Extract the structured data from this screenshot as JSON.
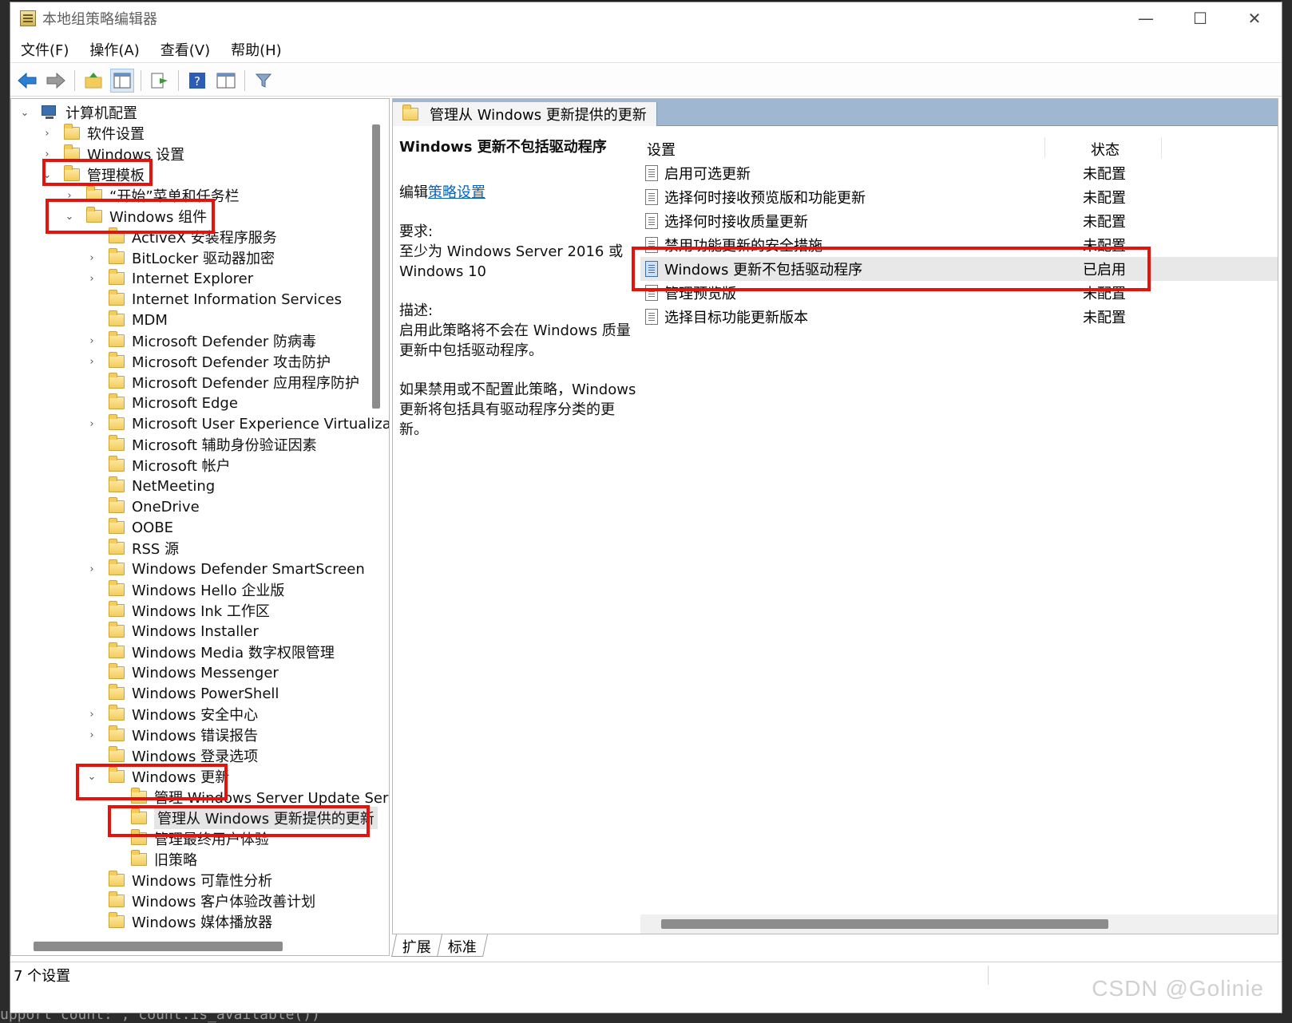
{
  "window": {
    "title": "本地组策略编辑器",
    "min": "—",
    "max": "☐",
    "close": "✕"
  },
  "menu": [
    "文件(F)",
    "操作(A)",
    "查看(V)",
    "帮助(H)"
  ],
  "toolbar": [
    "back-icon",
    "forward-icon",
    "up-folder-icon",
    "show-hide-tree-icon",
    "export-list-icon",
    "help-icon",
    "properties-view-icon",
    "filter-icon"
  ],
  "tree": {
    "root": "计算机配置",
    "items": [
      "软件设置",
      "Windows 设置",
      "管理模板",
      "“开始”菜单和任务栏",
      "Windows 组件",
      "ActiveX 安装程序服务",
      "BitLocker 驱动器加密",
      "Internet Explorer",
      "Internet Information Services",
      "MDM",
      "Microsoft Defender 防病毒",
      "Microsoft Defender 攻击防护",
      "Microsoft Defender 应用程序防护",
      "Microsoft Edge",
      "Microsoft User Experience Virtualizatic",
      "Microsoft 辅助身份验证因素",
      "Microsoft 帐户",
      "NetMeeting",
      "OneDrive",
      "OOBE",
      "RSS 源",
      "Windows Defender SmartScreen",
      "Windows Hello 企业版",
      "Windows Ink 工作区",
      "Windows Installer",
      "Windows Media 数字权限管理",
      "Windows Messenger",
      "Windows PowerShell",
      "Windows 安全中心",
      "Windows 错误报告",
      "Windows 登录选项",
      "Windows 更新",
      "管理 Windows Server Update Serv",
      "管理从 Windows 更新提供的更新",
      "管理最终用户体验",
      "旧策略",
      "Windows 可靠性分析",
      "Windows 客户体验改善计划",
      "Windows 媒体播放器"
    ]
  },
  "right": {
    "header": "管理从 Windows 更新提供的更新",
    "desc_title": "Windows 更新不包括驱动程序",
    "edit_prefix": "编辑",
    "edit_link": "策略设置",
    "req_label": "要求:",
    "req_text": "至少为 Windows Server 2016 或 Windows 10",
    "desc_label": "描述:",
    "desc_text": "启用此策略将不会在 Windows 质量更新中包括驱动程序。",
    "desc_text2": "如果禁用或不配置此策略，Windows 更新将包括具有驱动程序分类的更新。",
    "col_setting": "设置",
    "col_state": "状态",
    "rows": [
      {
        "name": "启用可选更新",
        "state": "未配置"
      },
      {
        "name": "选择何时接收预览版和功能更新",
        "state": "未配置"
      },
      {
        "name": "选择何时接收质量更新",
        "state": "未配置"
      },
      {
        "name": "禁用功能更新的安全措施",
        "state": "未配置"
      },
      {
        "name": "Windows 更新不包括驱动程序",
        "state": "已启用"
      },
      {
        "name": "管理预览版",
        "state": "未配置"
      },
      {
        "name": "选择目标功能更新版本",
        "state": "未配置"
      }
    ]
  },
  "tabs": [
    "扩展",
    "标准"
  ],
  "status": "7 个设置",
  "watermark": "CSDN @Golinie",
  "bg_code": "upport  count:  ,  count.is_available())"
}
